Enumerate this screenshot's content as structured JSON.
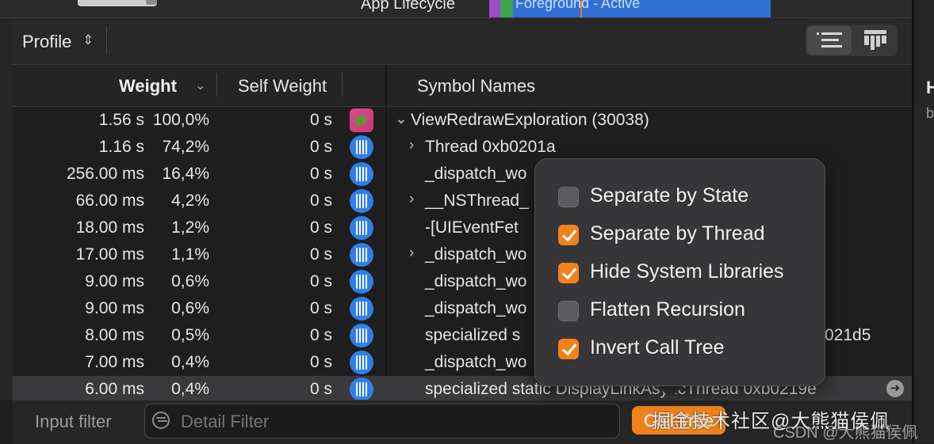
{
  "top": {
    "track_label": "App Lifecycle",
    "lane_text": "Foreground - Active"
  },
  "toolbar": {
    "profile_label": "Profile",
    "profile_chevron": "⌃⌄"
  },
  "right_panel": {
    "heading": "H",
    "sub": "b"
  },
  "columns": {
    "weight": "Weight",
    "self_weight": "Self Weight",
    "symbol_names": "Symbol Names"
  },
  "rows": [
    {
      "weight": "1.56 s",
      "pct": "100,0%",
      "self": "0 s",
      "icon": "app-icon",
      "disc": "⌄",
      "symbol": "ViewRedrawExploration (30038)",
      "indent": 0
    },
    {
      "weight": "1.16 s",
      "pct": "74,2%",
      "self": "0 s",
      "icon": "thread-icon",
      "disc": "›",
      "symbol": "Thread  0xb0201a",
      "indent": 1
    },
    {
      "weight": "256.00 ms",
      "pct": "16,4%",
      "self": "0 s",
      "icon": "thread-icon",
      "disc": "",
      "symbol": "_dispatch_wo",
      "indent": 1
    },
    {
      "weight": "66.00 ms",
      "pct": "4,2%",
      "self": "0 s",
      "icon": "thread-icon",
      "disc": "›",
      "symbol": "__NSThread_",
      "indent": 1
    },
    {
      "weight": "18.00 ms",
      "pct": "1,2%",
      "self": "0 s",
      "icon": "thread-icon",
      "disc": "",
      "symbol": "-[UIEventFet",
      "indent": 1
    },
    {
      "weight": "17.00 ms",
      "pct": "1,1%",
      "self": "0 s",
      "icon": "thread-icon",
      "disc": "›",
      "symbol": "_dispatch_wo",
      "indent": 1
    },
    {
      "weight": "9.00 ms",
      "pct": "0,6%",
      "self": "0 s",
      "icon": "thread-icon",
      "disc": "",
      "symbol": "_dispatch_wo",
      "indent": 1
    },
    {
      "weight": "9.00 ms",
      "pct": "0,6%",
      "self": "0 s",
      "icon": "thread-icon",
      "disc": "",
      "symbol": "_dispatch_wo",
      "indent": 1
    },
    {
      "weight": "8.00 ms",
      "pct": "0,5%",
      "self": "0 s",
      "icon": "thread-icon",
      "disc": "",
      "symbol": "specialized s",
      "tail": "021d5",
      "indent": 1
    },
    {
      "weight": "7.00 ms",
      "pct": "0,4%",
      "self": "0 s",
      "icon": "thread-icon",
      "disc": "",
      "symbol": "_dispatch_wo",
      "indent": 1
    },
    {
      "weight": "6.00 ms",
      "pct": "0,4%",
      "self": "0 s",
      "icon": "thread-icon",
      "disc": "",
      "symbol": "specialized static DisplayLinkAsyncThread  0xb0219e",
      "indent": 1,
      "selected": true
    }
  ],
  "popover": {
    "options": [
      {
        "label": "Separate by State",
        "checked": false
      },
      {
        "label": "Separate by Thread",
        "checked": true
      },
      {
        "label": "Hide System Libraries",
        "checked": true
      },
      {
        "label": "Flatten Recursion",
        "checked": false
      },
      {
        "label": "Invert Call Tree",
        "checked": true
      }
    ]
  },
  "bottom": {
    "input_filter": "Input filter",
    "detail_placeholder": "Detail Filter",
    "call_tree_button": "Call Tree"
  },
  "watermark": {
    "line1": "掘金技术社区@大熊猫侯佩",
    "line2": "CSDN @大熊猫侯佩"
  }
}
